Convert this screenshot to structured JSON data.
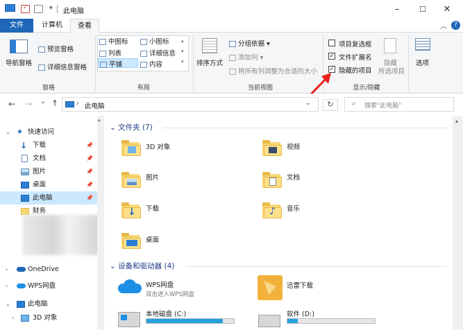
{
  "window": {
    "title": "此电脑",
    "dropdown_glyph": "▾",
    "minimize": "–",
    "maximize": "☐",
    "close": "✕",
    "ribbon_collapse": "︿",
    "help": "?"
  },
  "tabs": {
    "file": "文件",
    "computer": "计算机",
    "view": "查看"
  },
  "ribbon": {
    "panes": {
      "nav_pane": "导航窗格",
      "preview": "预览窗格",
      "details": "详细信息窗格",
      "group": "窗格"
    },
    "layout": {
      "medium_icons": "中图标",
      "small_icons": "小图标",
      "list": "列表",
      "details": "详细信息",
      "tiles": "平铺",
      "content": "内容",
      "group": "布局"
    },
    "current_view": {
      "sort_by": "排序方式",
      "group_by": "分组依据",
      "add_columns": "添加列",
      "fit_columns": "将所有列调整为合适的大小",
      "group": "当前视图"
    },
    "show_hide": {
      "item_checkboxes": "项目复选框",
      "item_checkboxes_checked": false,
      "file_ext": "文件扩展名",
      "file_ext_checked": true,
      "hidden_items": "隐藏的项目",
      "hidden_items_checked": true,
      "hide": "隐藏",
      "hide_selected": "所选项目",
      "options": "选项",
      "group": "显示/隐藏"
    }
  },
  "navbar": {
    "back": "←",
    "forward": "→",
    "recent": "⌄",
    "up": "↑",
    "path": "此电脑",
    "path_sep": "›",
    "refresh": "↻",
    "search_placeholder": "搜索\"此电脑\""
  },
  "nav": {
    "quick_access": "快速访问",
    "items": [
      {
        "label": "下载"
      },
      {
        "label": "文档"
      },
      {
        "label": "图片"
      },
      {
        "label": "桌面"
      },
      {
        "label": "此电脑"
      },
      {
        "label": "财务"
      }
    ],
    "onedrive": "OneDrive",
    "wps": "WPS网盘",
    "this_pc": "此电脑",
    "objects_3d": "3D 对象"
  },
  "content": {
    "folders_header": "文件夹 (7)",
    "folders": [
      "3D 对象",
      "视频",
      "图片",
      "文档",
      "下载",
      "音乐",
      "桌面"
    ],
    "devices_header": "设备和驱动器 (4)",
    "wps_title": "WPS网盘",
    "wps_sub": "双击进入WPS网盘",
    "xunlei": "迅雷下载",
    "drive_c": "本地磁盘 (C:)",
    "drive_c_used": 0.87,
    "drive_d": "软件 (D:)",
    "drive_d_used": 0.12
  },
  "colors": {
    "accent": "#1e67b8",
    "arrow": "#e8201c",
    "selection": "#cce8ff",
    "header": "#1e3d8a"
  }
}
